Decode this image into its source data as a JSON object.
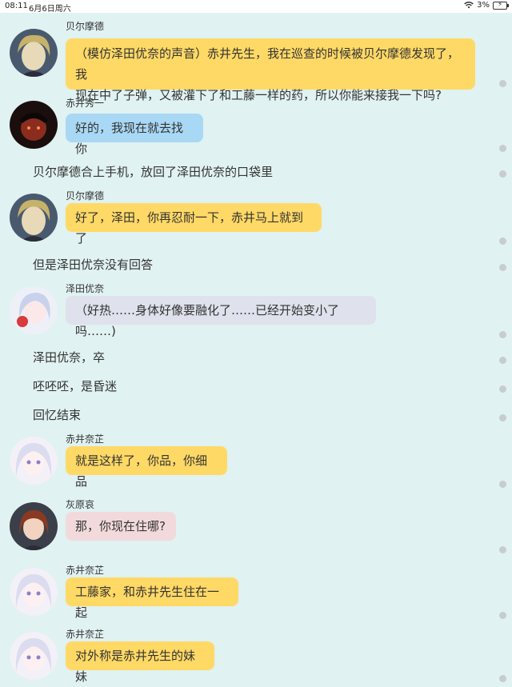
{
  "status_bar": {
    "time": "08:11",
    "date": "6月6日周六",
    "battery": "3%"
  },
  "messages": [
    {
      "kind": "bubble",
      "speaker": "贝尔摩德",
      "avatar": "vermouth-avatar",
      "color": "yellow",
      "lines": [
        "（模仿泽田优奈的声音）赤井先生，我在巡查的时候被贝尔摩德发现了，我",
        "现在中了子弹，又被灌下了和工藤一样的药，所以你能来接我一下吗?"
      ]
    },
    {
      "kind": "bubble",
      "speaker": "赤井秀一",
      "avatar": "akai-shuichi-avatar",
      "color": "blue",
      "lines": [
        "好的，我现在就去找你"
      ]
    },
    {
      "kind": "narration",
      "text": "贝尔摩德合上手机，放回了泽田优奈的口袋里"
    },
    {
      "kind": "bubble",
      "speaker": "贝尔摩德",
      "avatar": "vermouth-avatar",
      "color": "yellow",
      "lines": [
        "好了，泽田，你再忍耐一下，赤井马上就到了"
      ]
    },
    {
      "kind": "narration",
      "text": "但是泽田优奈没有回答"
    },
    {
      "kind": "bubble",
      "speaker": "泽田优奈",
      "avatar": "sawada-yuna-avatar",
      "color": "gray",
      "lines": [
        "（好热……身体好像要融化了……已经开始变小了吗……)"
      ]
    },
    {
      "kind": "narration",
      "text": "泽田优奈，卒"
    },
    {
      "kind": "narration",
      "text": "呸呸呸，是昏迷"
    },
    {
      "kind": "narration",
      "text": "回忆结束"
    },
    {
      "kind": "bubble",
      "speaker": "赤井奈芷",
      "avatar": "akai-naizhi-avatar",
      "color": "yellow",
      "lines": [
        "就是这样了，你品，你细品"
      ]
    },
    {
      "kind": "bubble",
      "speaker": "灰原哀",
      "avatar": "haibara-ai-avatar",
      "color": "pink",
      "lines": [
        "那，你现在住哪?"
      ]
    },
    {
      "kind": "bubble",
      "speaker": "赤井奈芷",
      "avatar": "akai-naizhi-avatar",
      "color": "yellow",
      "lines": [
        "工藤家，和赤井先生住在一起"
      ]
    },
    {
      "kind": "bubble",
      "speaker": "赤井奈芷",
      "avatar": "akai-naizhi-avatar",
      "color": "yellow",
      "lines": [
        "对外称是赤井先生的妹妹"
      ]
    }
  ],
  "colors": {
    "background": "#e0f2f1",
    "yellow": "#ffd966",
    "blue": "#a9d8f5",
    "gray": "#dfe2ec",
    "pink": "#f2dadc"
  }
}
